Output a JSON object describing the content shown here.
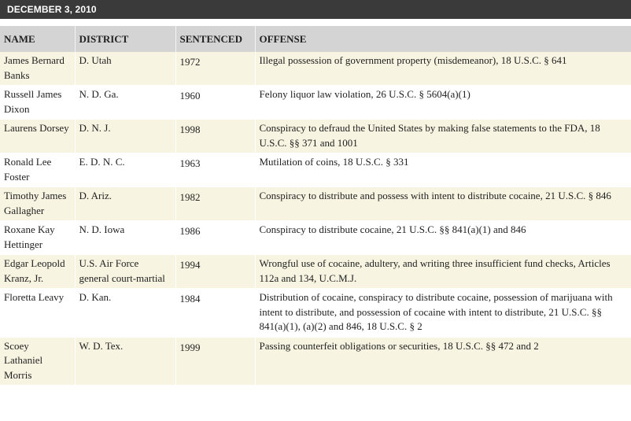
{
  "header": {
    "date": "DECEMBER 3, 2010"
  },
  "table": {
    "columns": [
      "NAME",
      "DISTRICT",
      "SENTENCED",
      "OFFENSE"
    ],
    "rows": [
      {
        "name": "James Bernard Banks",
        "district": "D. Utah",
        "sentenced": "1972",
        "offense": "Illegal possession of government property (misdemeanor), 18 U.S.C. § 641"
      },
      {
        "name": "Russell James Dixon",
        "district": "N. D. Ga.",
        "sentenced": "1960",
        "offense": "Felony liquor law violation, 26 U.S.C. § 5604(a)(1)"
      },
      {
        "name": "Laurens Dorsey",
        "district": "D. N. J.",
        "sentenced": "1998",
        "offense": "Conspiracy to defraud the United States by making false statements to the FDA, 18 U.S.C. §§ 371 and 1001"
      },
      {
        "name": "Ronald Lee Foster",
        "district": "E. D. N. C.",
        "sentenced": "1963",
        "offense": "Mutilation of coins, 18 U.S.C. § 331"
      },
      {
        "name": "Timothy James Gallagher",
        "district": "D. Ariz.",
        "sentenced": "1982",
        "offense": "Conspiracy to distribute and possess with intent to distribute cocaine, 21 U.S.C. § 846"
      },
      {
        "name": "Roxane Kay Hettinger",
        "district": "N. D. Iowa",
        "sentenced": "1986",
        "offense": "Conspiracy to distribute cocaine, 21 U.S.C. §§ 841(a)(1) and 846"
      },
      {
        "name": "Edgar Leopold Kranz, Jr.",
        "district": "U.S. Air Force general court-martial",
        "sentenced": "1994",
        "offense": "Wrongful use of cocaine, adultery, and writing three insufficient fund checks, Articles 112a and 134, U.C.M.J."
      },
      {
        "name": "Floretta Leavy",
        "district": "D. Kan.",
        "sentenced": "1984",
        "offense": "Distribution of cocaine, conspiracy to distribute cocaine, possession of marijuana with intent to distribute, and possession of cocaine with intent to distribute, 21 U.S.C. §§ 841(a)(1), (a)(2) and 846, 18 U.S.C. § 2"
      },
      {
        "name": "Scoey Lathaniel Morris",
        "district": "W. D. Tex.",
        "sentenced": "1999",
        "offense": "Passing counterfeit obligations or securities, 18 U.S.C. §§ 472 and 2"
      }
    ]
  }
}
